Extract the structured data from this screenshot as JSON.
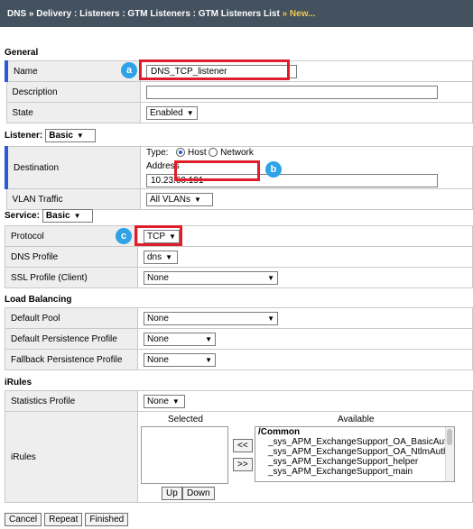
{
  "breadcrumb": {
    "parts": [
      "DNS",
      "Delivery",
      "Listeners",
      "GTM Listeners",
      "GTM Listeners List"
    ],
    "new_label": "New..."
  },
  "sections": {
    "general": "General",
    "listener": "Listener:",
    "service": "Service:",
    "load_balancing": "Load Balancing",
    "irules": "iRules"
  },
  "general": {
    "name_label": "Name",
    "name_value": "DNS_TCP_listener",
    "description_label": "Description",
    "description_value": "",
    "state_label": "State",
    "state_value": "Enabled"
  },
  "listener": {
    "mode_value": "Basic",
    "destination_label": "Destination",
    "type_label": "Type:",
    "type_host": "Host",
    "type_network": "Network",
    "address_label": "Address",
    "address_value": "10.23.60.191",
    "vlan_label": "VLAN Traffic",
    "vlan_value": "All VLANs"
  },
  "service": {
    "mode_value": "Basic",
    "protocol_label": "Protocol",
    "protocol_value": "TCP",
    "dns_profile_label": "DNS Profile",
    "dns_profile_value": "dns",
    "ssl_profile_label": "SSL Profile (Client)",
    "ssl_profile_value": "None"
  },
  "load_balancing": {
    "default_pool_label": "Default Pool",
    "default_pool_value": "None",
    "default_persistence_label": "Default Persistence Profile",
    "default_persistence_value": "None",
    "fallback_persistence_label": "Fallback Persistence Profile",
    "fallback_persistence_value": "None"
  },
  "irules": {
    "stats_profile_label": "Statistics Profile",
    "stats_profile_value": "None",
    "irules_label": "iRules",
    "selected_label": "Selected",
    "available_label": "Available",
    "available_group": "/Common",
    "available_items": [
      "_sys_APM_ExchangeSupport_OA_BasicAuth",
      "_sys_APM_ExchangeSupport_OA_NtlmAuth",
      "_sys_APM_ExchangeSupport_helper",
      "_sys_APM_ExchangeSupport_main"
    ],
    "move_left": "<<",
    "move_right": ">>",
    "up": "Up",
    "down": "Down"
  },
  "annotations": {
    "a": "a",
    "b": "b",
    "c": "c"
  },
  "buttons": {
    "cancel": "Cancel",
    "repeat": "Repeat",
    "finished": "Finished"
  },
  "colors": {
    "header_bg": "#44515f",
    "new_link": "#f2c94c",
    "highlight_box": "#e01e2b",
    "badge": "#2fa3e6"
  }
}
